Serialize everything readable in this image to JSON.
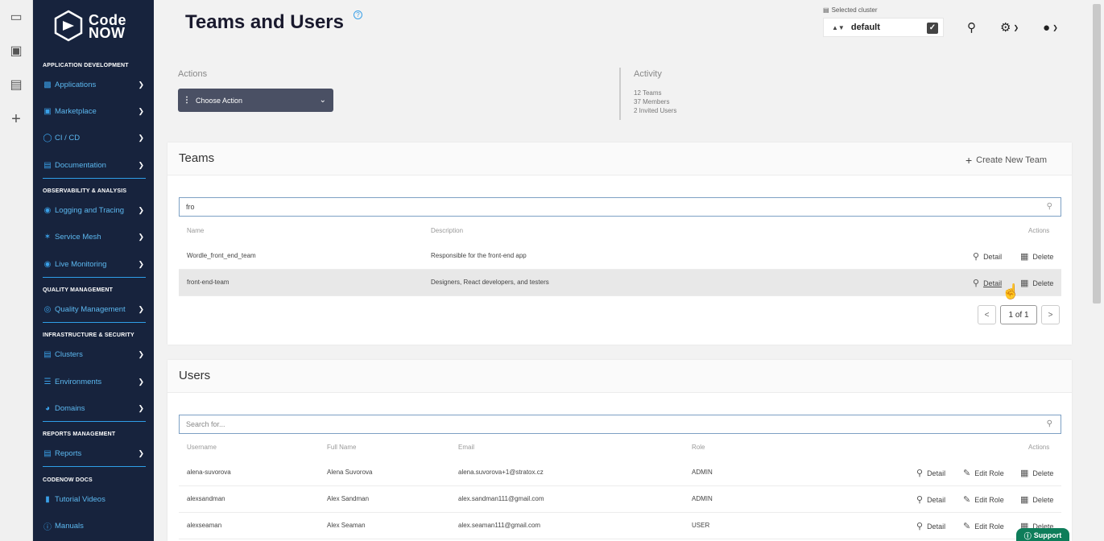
{
  "rail": {
    "icons": [
      "video-icon",
      "wallet-icon",
      "book-icon",
      "plus-icon"
    ]
  },
  "logo": {
    "line1": "Code",
    "line2": "NOW"
  },
  "sidebar": {
    "sections": [
      {
        "title": "APPLICATION DEVELOPMENT",
        "items": [
          {
            "label": "Applications",
            "icon": "laptop-icon"
          },
          {
            "label": "Marketplace",
            "icon": "cart-icon"
          },
          {
            "label": "CI / CD",
            "icon": "cycle-icon"
          },
          {
            "label": "Documentation",
            "icon": "book-icon"
          }
        ]
      },
      {
        "title": "OBSERVABILITY & ANALYSIS",
        "items": [
          {
            "label": "Logging and Tracing",
            "icon": "binoculars-icon"
          },
          {
            "label": "Service Mesh",
            "icon": "mesh-icon"
          },
          {
            "label": "Live Monitoring",
            "icon": "binoculars-icon"
          }
        ]
      },
      {
        "title": "QUALITY MANAGEMENT",
        "items": [
          {
            "label": "Quality Management",
            "icon": "badge-icon"
          }
        ]
      },
      {
        "title": "INFRASTRUCTURE & SECURITY",
        "items": [
          {
            "label": "Clusters",
            "icon": "server-icon"
          },
          {
            "label": "Environments",
            "icon": "layers-icon"
          },
          {
            "label": "Domains",
            "icon": "globe-icon"
          }
        ]
      },
      {
        "title": "REPORTS MANAGEMENT",
        "items": [
          {
            "label": "Reports",
            "icon": "file-icon"
          }
        ]
      },
      {
        "title": "CODENOW DOCS",
        "items": [
          {
            "label": "Tutorial Videos",
            "icon": "video-icon"
          },
          {
            "label": "Manuals",
            "icon": "help-icon"
          }
        ]
      }
    ]
  },
  "header": {
    "title": "Teams and Users",
    "help": "?",
    "cluster_label": "Selected cluster",
    "cluster_value": "default"
  },
  "actions": {
    "label": "Actions",
    "choose": "Choose Action"
  },
  "activity": {
    "label": "Activity",
    "lines": [
      "12 Teams",
      "37 Members",
      "2 Invited Users"
    ]
  },
  "teams": {
    "title": "Teams",
    "create": "Create New Team",
    "search_value": "fro",
    "columns": [
      "Name",
      "Description",
      "Actions"
    ],
    "rows": [
      {
        "name": "Wordle_front_end_team",
        "description": "Responsible for the front-end app"
      },
      {
        "name": "front-end-team",
        "description": "Designers, React developers, and testers"
      }
    ],
    "detail": "Detail",
    "delete": "Delete",
    "pager": {
      "prev": "<",
      "page": "1 of 1",
      "next": ">"
    }
  },
  "users": {
    "title": "Users",
    "search_placeholder": "Search for...",
    "columns": [
      "Username",
      "Full Name",
      "Email",
      "Role",
      "Actions"
    ],
    "rows": [
      {
        "username": "alena-suvorova",
        "full_name": "Alena Suvorova",
        "email": "alena.suvorova+1@stratox.cz",
        "role": "ADMIN"
      },
      {
        "username": "alexsandman",
        "full_name": "Alex Sandman",
        "email": "alex.sandman111@gmail.com",
        "role": "ADMIN"
      },
      {
        "username": "alexseaman",
        "full_name": "Alex Seaman",
        "email": "alex.seaman111@gmail.com",
        "role": "USER"
      }
    ],
    "detail": "Detail",
    "edit_role": "Edit Role",
    "delete": "Delete"
  },
  "support": "Support",
  "colors": {
    "sidebar_bg": "#17233d",
    "accent": "#3aa0e8",
    "support_bg": "#0e7d5a"
  }
}
